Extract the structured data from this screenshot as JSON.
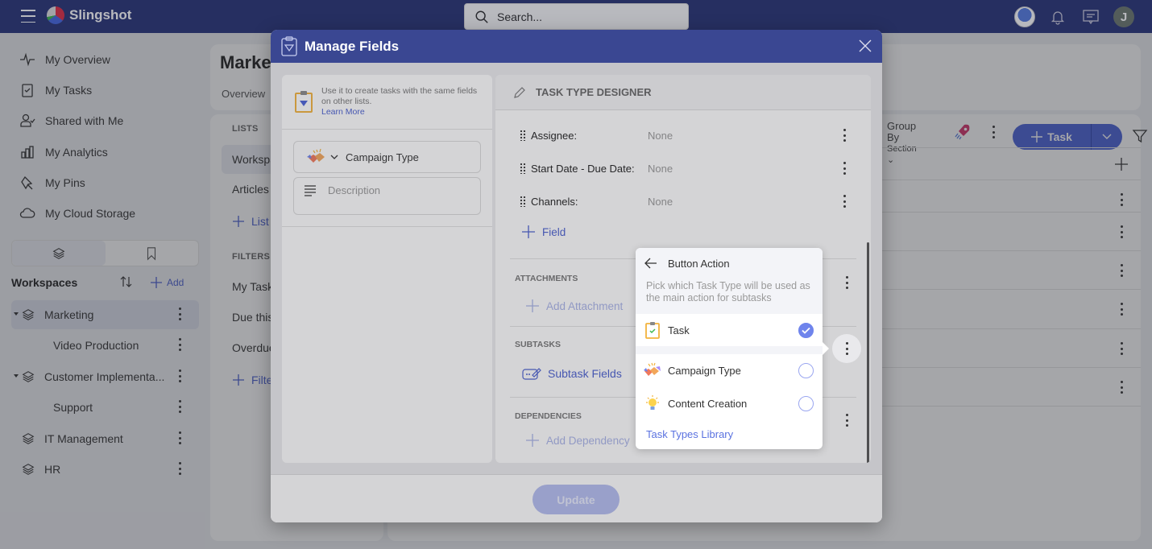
{
  "topbar": {
    "app_name": "Slingshot",
    "search_placeholder": "Search...",
    "user_initial": "J",
    "icons": [
      "menu-icon",
      "search-icon",
      "avatar-photo",
      "bell-icon",
      "chat-icon",
      "user-avatar"
    ]
  },
  "sidebar": {
    "nav": [
      {
        "label": "My Overview",
        "icon": "activity-icon"
      },
      {
        "label": "My Tasks",
        "icon": "clipboard-check-icon"
      },
      {
        "label": "Shared with Me",
        "icon": "user-check-icon"
      },
      {
        "label": "My Analytics",
        "icon": "bar-chart-icon"
      },
      {
        "label": "My Pins",
        "icon": "pin-icon"
      },
      {
        "label": "My Cloud Storage",
        "icon": "cloud-icon"
      }
    ],
    "workspaces_label": "Workspaces",
    "add_label": "Add",
    "workspaces": [
      {
        "label": "Marketing",
        "level": 0,
        "expanded": true,
        "active": true
      },
      {
        "label": "Video Production",
        "level": 1
      },
      {
        "label": "Customer Implementa...",
        "level": 0,
        "expanded": true
      },
      {
        "label": "Support",
        "level": 1
      },
      {
        "label": "IT Management",
        "level": 0
      },
      {
        "label": "HR",
        "level": 0
      }
    ]
  },
  "main": {
    "title": "Marke",
    "tab": "Overview",
    "lists_label": "LISTS",
    "lists": [
      "Workspa",
      "Articles"
    ],
    "add_list": "List",
    "filters_label": "FILTERS",
    "filters": [
      "My Task",
      "Due this",
      "Overdue"
    ],
    "add_filter": "Filte",
    "group_by_label": "Group By",
    "group_by_value": "Section",
    "task_button": "Task"
  },
  "modal": {
    "title": "Manage Fields",
    "info_text": "Use it to create tasks with the same fields on other lists.",
    "learn_more": "Learn More",
    "task_type_name": "Campaign Type",
    "description_placeholder": "Description",
    "designer_title": "TASK TYPE DESIGNER",
    "fields": [
      {
        "label": "Assignee:",
        "value": "None"
      },
      {
        "label": "Start Date - Due Date:",
        "value": "None"
      },
      {
        "label": "Channels:",
        "value": "None"
      }
    ],
    "add_field": "Field",
    "attachments_label": "ATTACHMENTS",
    "add_attachment": "Add Attachment",
    "subtasks_label": "SUBTASKS",
    "subtask_fields": "Subtask Fields",
    "dependencies_label": "DEPENDENCIES",
    "add_dependency": "Add Dependency",
    "update_button": "Update"
  },
  "popover": {
    "title": "Button Action",
    "description": "Pick which Task Type will be used as the main action for subtasks",
    "options": [
      {
        "label": "Task",
        "selected": true,
        "icon": "clipboard-check-icon"
      },
      {
        "label": "Campaign Type",
        "selected": false,
        "icon": "handshake-icon"
      },
      {
        "label": "Content Creation",
        "selected": false,
        "icon": "lightbulb-icon"
      }
    ],
    "library_link": "Task Types Library"
  },
  "colors": {
    "topbar": "#2f3a7a",
    "modal_header": "#3a4792",
    "accent": "#4a62d8",
    "link": "#4a5fd0"
  }
}
